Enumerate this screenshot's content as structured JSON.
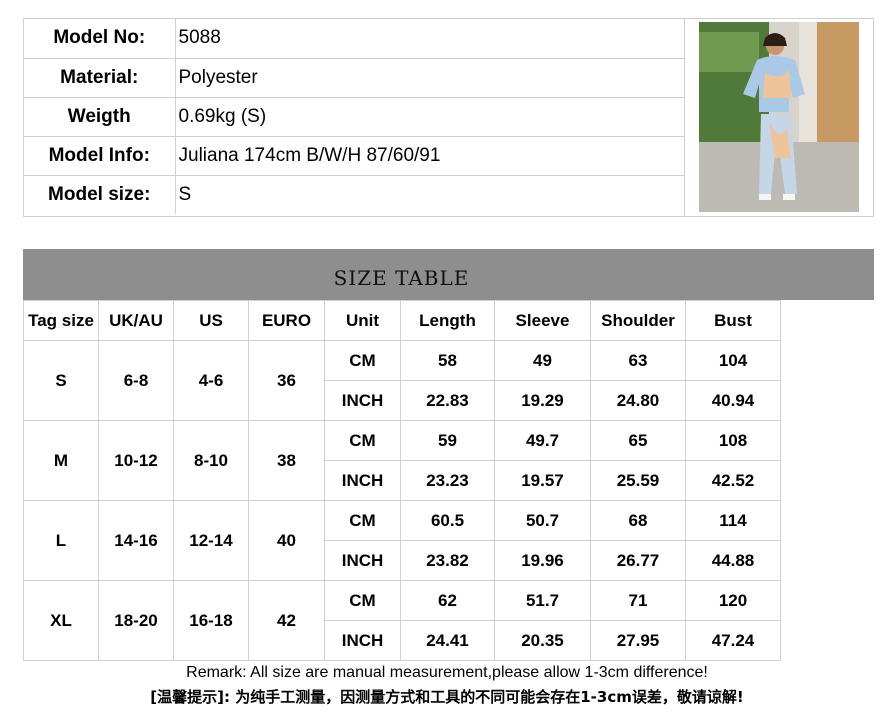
{
  "info": {
    "rows": [
      {
        "label": "Model No:",
        "value": "5088"
      },
      {
        "label": "Material:",
        "value": "Polyester"
      },
      {
        "label": "Weigth",
        "value": "0.69kg (S)"
      },
      {
        "label": "Model Info:",
        "value": "Juliana 174cm B/W/H 87/60/91"
      },
      {
        "label": "Model size:",
        "value": "S"
      }
    ],
    "photo_colors": {
      "top": "#a9c9e6",
      "accent": "#f0c49a"
    }
  },
  "size_table": {
    "title": "SIZE TABLE",
    "columns": [
      "Tag size",
      "UK/AU",
      "US",
      "EURO",
      "Unit",
      "Length",
      "Sleeve",
      "Shoulder",
      "Bust"
    ],
    "sizes": [
      {
        "tag": "S",
        "uk": "6-8",
        "us": "4-6",
        "euro": "36",
        "cm": {
          "unit": "CM",
          "length": "58",
          "sleeve": "49",
          "shoulder": "63",
          "bust": "104"
        },
        "inch": {
          "unit": "INCH",
          "length": "22.83",
          "sleeve": "19.29",
          "shoulder": "24.80",
          "bust": "40.94"
        }
      },
      {
        "tag": "M",
        "uk": "10-12",
        "us": "8-10",
        "euro": "38",
        "cm": {
          "unit": "CM",
          "length": "59",
          "sleeve": "49.7",
          "shoulder": "65",
          "bust": "108"
        },
        "inch": {
          "unit": "INCH",
          "length": "23.23",
          "sleeve": "19.57",
          "shoulder": "25.59",
          "bust": "42.52"
        }
      },
      {
        "tag": "L",
        "uk": "14-16",
        "us": "12-14",
        "euro": "40",
        "cm": {
          "unit": "CM",
          "length": "60.5",
          "sleeve": "50.7",
          "shoulder": "68",
          "bust": "114"
        },
        "inch": {
          "unit": "INCH",
          "length": "23.82",
          "sleeve": "19.96",
          "shoulder": "26.77",
          "bust": "44.88"
        }
      },
      {
        "tag": "XL",
        "uk": "18-20",
        "us": "16-18",
        "euro": "42",
        "cm": {
          "unit": "CM",
          "length": "62",
          "sleeve": "51.7",
          "shoulder": "71",
          "bust": "120"
        },
        "inch": {
          "unit": "INCH",
          "length": "24.41",
          "sleeve": "20.35",
          "shoulder": "27.95",
          "bust": "47.24"
        }
      }
    ]
  },
  "remark": {
    "en": "Remark: All size are manual measurement,please allow 1-3cm difference!",
    "cn": "[温馨提示]: 为纯手工测量，因测量方式和工具的不同可能会存在1-3cm误差，敬请谅解!"
  }
}
